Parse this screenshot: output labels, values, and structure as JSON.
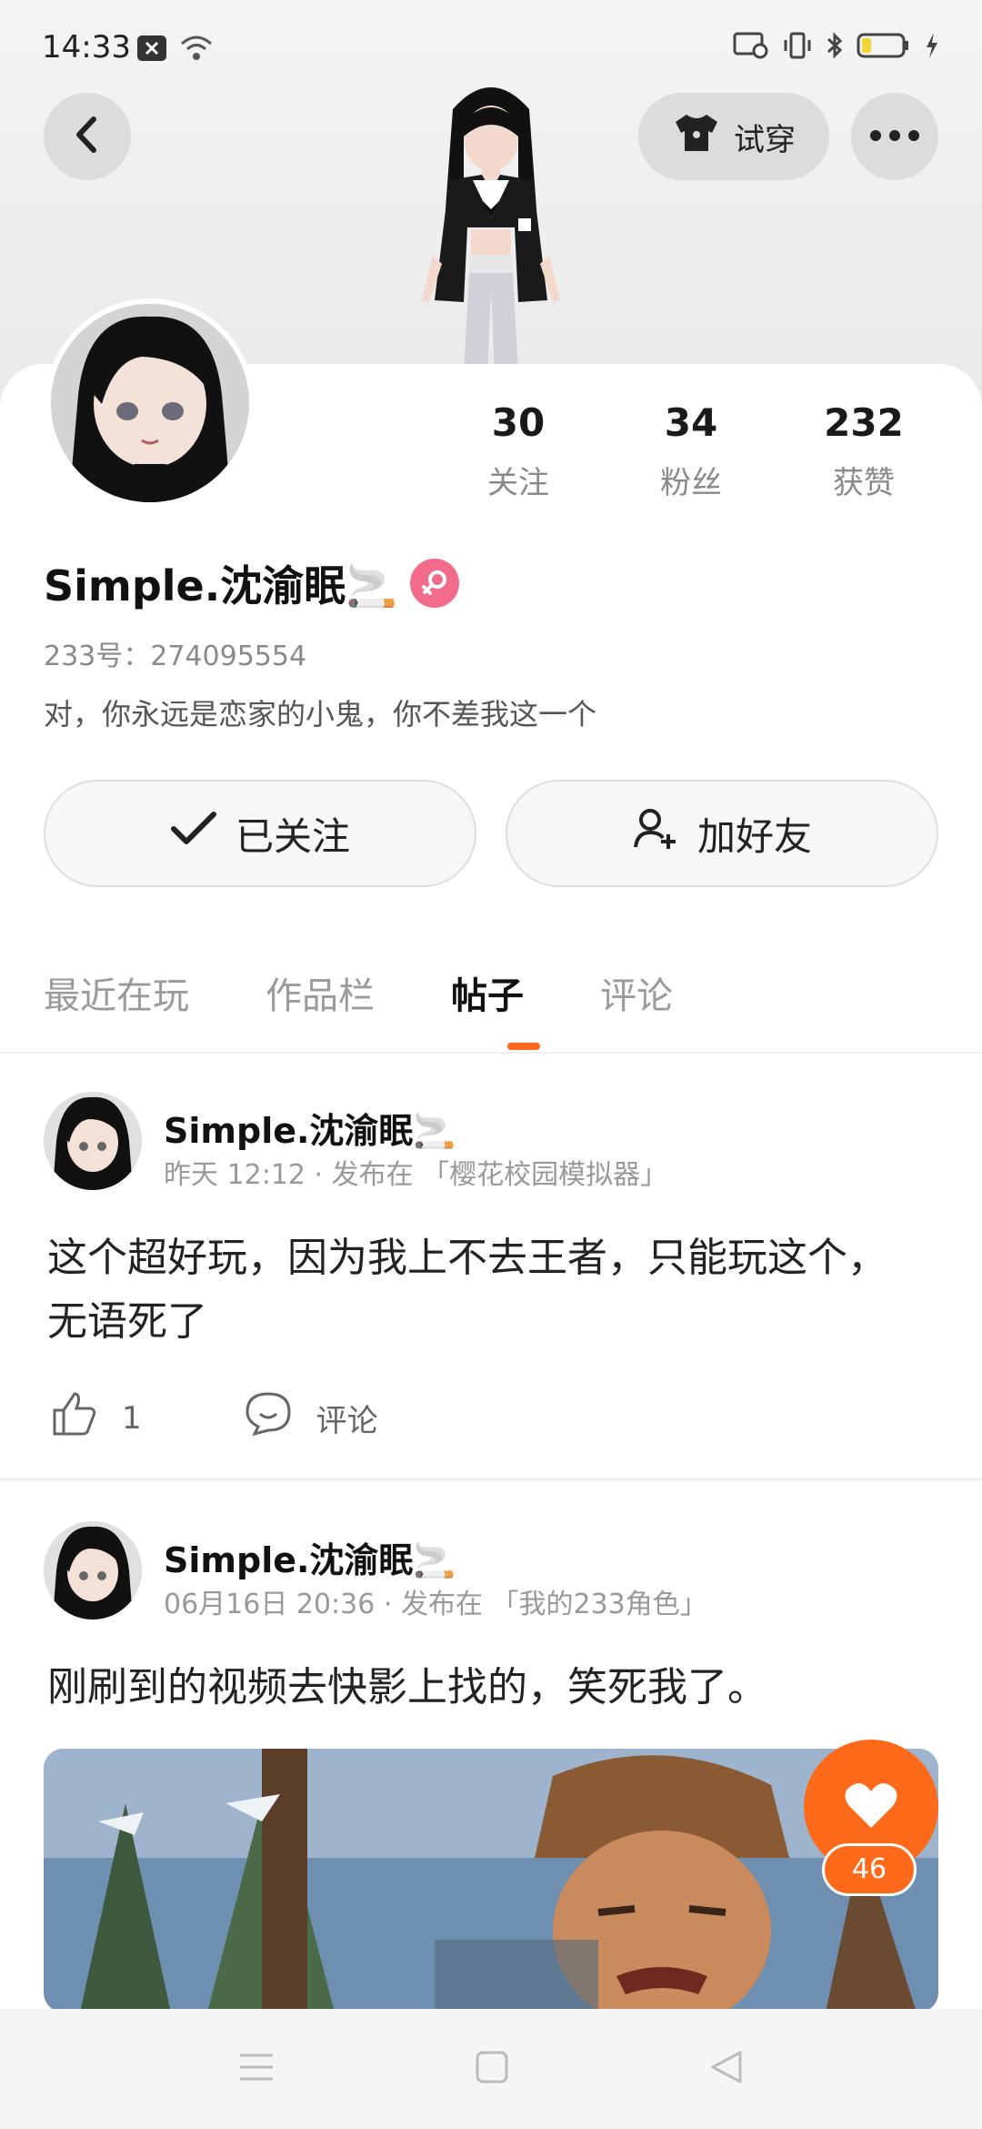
{
  "status_bar": {
    "time": "14:33"
  },
  "header": {
    "try_on_label": "试穿"
  },
  "profile": {
    "stats": [
      {
        "value": "30",
        "label": "关注"
      },
      {
        "value": "34",
        "label": "粉丝"
      },
      {
        "value": "232",
        "label": "获赞"
      }
    ],
    "name": "Simple.沈渝眠🚬",
    "account_id": "233号：274095554",
    "bio": "对，你永远是恋家的小鬼，你不差我这一个",
    "followed_label": "已关注",
    "add_friend_label": "加好友"
  },
  "tabs": [
    {
      "label": "最近在玩",
      "active": false
    },
    {
      "label": "作品栏",
      "active": false
    },
    {
      "label": "帖子",
      "active": true
    },
    {
      "label": "评论",
      "active": false
    }
  ],
  "posts": [
    {
      "author": "Simple.沈渝眠🚬",
      "meta": "昨天 12:12 · 发布在 「樱花校园模拟器」",
      "text": "这个超好玩，因为我上不去王者，只能玩这个，无语死了",
      "like_count": "1",
      "comment_label": "评论"
    },
    {
      "author": "Simple.沈渝眠🚬",
      "meta": "06月16日 20:36 · 发布在 「我的233角色」",
      "text": "刚刷到的视频去快影上找的，笑死我了。"
    }
  ],
  "floating_like": {
    "count": "46"
  },
  "colors": {
    "accent": "#ff6a1a",
    "gender": "#f36b8a"
  }
}
